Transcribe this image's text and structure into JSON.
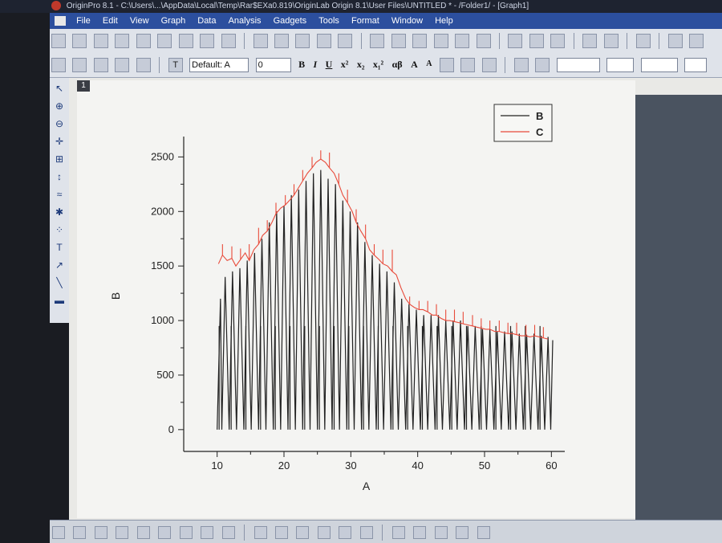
{
  "window": {
    "title": "OriginPro 8.1 - C:\\Users\\...\\AppData\\Local\\Temp\\Rar$EXa0.819\\OriginLab Origin 8.1\\User Files\\UNTITLED * - /Folder1/ - [Graph1]"
  },
  "menu": {
    "items": [
      "File",
      "Edit",
      "View",
      "Graph",
      "Data",
      "Analysis",
      "Gadgets",
      "Tools",
      "Format",
      "Window",
      "Help"
    ]
  },
  "format_toolbar": {
    "font_name": "Default: A",
    "font_size": "0",
    "bold": "B",
    "italic": "I",
    "underline": "U",
    "superscript": "x²",
    "subscript": "x₂",
    "supsub": "x₁²",
    "greek": "αβ",
    "bigger": "A",
    "smaller": "A"
  },
  "left_tools": {
    "icons": [
      "pointer-icon",
      "zoom-in-icon",
      "zoom-out-icon",
      "data-reader-icon",
      "screen-reader-icon",
      "data-selector-icon",
      "draw-data-icon",
      "mask-icon",
      "regional-selector-icon",
      "text-tool-icon",
      "arrow-tool-icon",
      "line-tool-icon",
      "rectangle-tool-icon"
    ]
  },
  "page": {
    "layer_number": "1"
  },
  "chart_data": {
    "type": "line",
    "xlabel": "A",
    "ylabel": "B",
    "xlim": [
      5,
      62
    ],
    "ylim": [
      -200,
      2650
    ],
    "xticks": [
      10,
      20,
      30,
      40,
      50,
      60
    ],
    "yticks": [
      0,
      500,
      1000,
      1500,
      2000,
      2500
    ],
    "legend_position": "top-right",
    "series": [
      {
        "name": "B",
        "color": "#222222",
        "peaks": [
          [
            10.5,
            1200
          ],
          [
            11.2,
            1400
          ],
          [
            12.3,
            1450
          ],
          [
            13.4,
            1480
          ],
          [
            14.5,
            1550
          ],
          [
            15.6,
            1620
          ],
          [
            16.7,
            1750
          ],
          [
            17.8,
            1900
          ],
          [
            18.9,
            2000
          ],
          [
            20,
            2050
          ],
          [
            21.1,
            2150
          ],
          [
            22.2,
            2200
          ],
          [
            23.3,
            2280
          ],
          [
            24.4,
            2350
          ],
          [
            25.5,
            2380
          ],
          [
            26.6,
            2300
          ],
          [
            27.7,
            2250
          ],
          [
            28.8,
            2100
          ],
          [
            29.9,
            2000
          ],
          [
            31,
            1900
          ],
          [
            32.1,
            1720
          ],
          [
            33.2,
            1600
          ],
          [
            34.3,
            1520
          ],
          [
            35.4,
            1450
          ],
          [
            36.5,
            1350
          ],
          [
            37.6,
            1200
          ],
          [
            38.7,
            1150
          ],
          [
            39.8,
            1100
          ],
          [
            40.9,
            1050
          ],
          [
            42,
            1050
          ],
          [
            43.1,
            1050
          ],
          [
            44.2,
            1000
          ],
          [
            45.3,
            1000
          ],
          [
            46.4,
            1000
          ],
          [
            47.5,
            950
          ],
          [
            48.6,
            950
          ],
          [
            49.7,
            920
          ],
          [
            50.8,
            920
          ],
          [
            51.9,
            900
          ],
          [
            53,
            900
          ],
          [
            54.1,
            900
          ],
          [
            55.2,
            880
          ],
          [
            56.3,
            870
          ],
          [
            57.4,
            880
          ],
          [
            58.5,
            860
          ],
          [
            59.5,
            850
          ]
        ],
        "mids": [
          [
            10.3,
            950
          ],
          [
            12.1,
            950
          ],
          [
            14.3,
            950
          ],
          [
            16.5,
            950
          ],
          [
            18.7,
            950
          ],
          [
            20.9,
            950
          ],
          [
            23.1,
            950
          ],
          [
            25.3,
            950
          ],
          [
            27.5,
            950
          ],
          [
            29.7,
            950
          ],
          [
            31.9,
            950
          ],
          [
            34.1,
            950
          ],
          [
            36.3,
            950
          ],
          [
            38.5,
            950
          ],
          [
            40.7,
            950
          ],
          [
            42.9,
            950
          ],
          [
            45.1,
            950
          ],
          [
            47.3,
            950
          ],
          [
            49.5,
            950
          ],
          [
            51.7,
            950
          ],
          [
            53.9,
            950
          ],
          [
            56.1,
            950
          ],
          [
            58.3,
            950
          ]
        ],
        "end": [
          [
            60.2,
            820
          ]
        ]
      },
      {
        "name": "C",
        "color": "#e84a3a",
        "values": [
          [
            10.2,
            1520
          ],
          [
            10.8,
            1600
          ],
          [
            11.5,
            1550
          ],
          [
            12.2,
            1570
          ],
          [
            12.8,
            1500
          ],
          [
            13.5,
            1560
          ],
          [
            14.2,
            1620
          ],
          [
            14.8,
            1550
          ],
          [
            15.5,
            1650
          ],
          [
            16.2,
            1700
          ],
          [
            16.8,
            1780
          ],
          [
            17.5,
            1820
          ],
          [
            18.2,
            1900
          ],
          [
            18.8,
            1980
          ],
          [
            19.5,
            2030
          ],
          [
            20.2,
            2060
          ],
          [
            20.8,
            2100
          ],
          [
            21.5,
            2150
          ],
          [
            22.2,
            2220
          ],
          [
            22.8,
            2280
          ],
          [
            23.5,
            2350
          ],
          [
            24.2,
            2400
          ],
          [
            24.8,
            2450
          ],
          [
            25.5,
            2480
          ],
          [
            26.2,
            2450
          ],
          [
            26.8,
            2400
          ],
          [
            27.5,
            2350
          ],
          [
            28.2,
            2250
          ],
          [
            28.8,
            2150
          ],
          [
            29.5,
            2080
          ],
          [
            30.2,
            2000
          ],
          [
            30.8,
            1900
          ],
          [
            31.5,
            1820
          ],
          [
            32.2,
            1750
          ],
          [
            32.8,
            1650
          ],
          [
            33.5,
            1600
          ],
          [
            34.2,
            1560
          ],
          [
            34.8,
            1520
          ],
          [
            35.5,
            1500
          ],
          [
            36.2,
            1450
          ],
          [
            36.8,
            1420
          ],
          [
            37.5,
            1300
          ],
          [
            38.2,
            1200
          ],
          [
            38.8,
            1150
          ],
          [
            39.5,
            1120
          ],
          [
            40.2,
            1100
          ],
          [
            40.8,
            1100
          ],
          [
            41.5,
            1080
          ],
          [
            42.2,
            1050
          ],
          [
            42.8,
            1050
          ],
          [
            43.5,
            1020
          ],
          [
            44.2,
            1000
          ],
          [
            44.8,
            1000
          ],
          [
            45.5,
            990
          ],
          [
            46.2,
            980
          ],
          [
            46.8,
            970
          ],
          [
            47.5,
            960
          ],
          [
            48.2,
            950
          ],
          [
            48.8,
            940
          ],
          [
            49.5,
            930
          ],
          [
            50.2,
            920
          ],
          [
            50.8,
            920
          ],
          [
            51.5,
            900
          ],
          [
            52.2,
            900
          ],
          [
            52.8,
            890
          ],
          [
            53.5,
            880
          ],
          [
            54.2,
            880
          ],
          [
            54.8,
            870
          ],
          [
            55.5,
            860
          ],
          [
            56.2,
            860
          ],
          [
            56.8,
            850
          ],
          [
            57.5,
            860
          ],
          [
            58.2,
            850
          ],
          [
            58.8,
            840
          ],
          [
            59.5,
            830
          ]
        ]
      }
    ],
    "c_spikes": [
      [
        10.8,
        1700
      ],
      [
        12.2,
        1680
      ],
      [
        13.5,
        1660
      ],
      [
        14.8,
        1700
      ],
      [
        16.2,
        1850
      ],
      [
        17.5,
        1920
      ],
      [
        18.8,
        2080
      ],
      [
        20.2,
        2150
      ],
      [
        21.5,
        2250
      ],
      [
        22.8,
        2380
      ],
      [
        24.2,
        2500
      ],
      [
        25.5,
        2560
      ],
      [
        26.8,
        2540
      ],
      [
        28.2,
        2350
      ],
      [
        29.5,
        2200
      ],
      [
        30.8,
        2020
      ],
      [
        32.2,
        1880
      ],
      [
        33.5,
        1700
      ],
      [
        34.8,
        1650
      ],
      [
        36.2,
        1650
      ],
      [
        37.5,
        1300
      ],
      [
        38.8,
        1220
      ],
      [
        40.2,
        1180
      ],
      [
        41.5,
        1180
      ],
      [
        42.8,
        1150
      ],
      [
        44.2,
        1100
      ],
      [
        45.5,
        1100
      ],
      [
        46.8,
        1080
      ],
      [
        48.2,
        1050
      ],
      [
        49.5,
        1020
      ],
      [
        50.8,
        1000
      ],
      [
        52.2,
        1000
      ],
      [
        53.5,
        980
      ],
      [
        54.8,
        980
      ],
      [
        56.2,
        960
      ],
      [
        57.5,
        960
      ],
      [
        58.8,
        940
      ]
    ]
  }
}
